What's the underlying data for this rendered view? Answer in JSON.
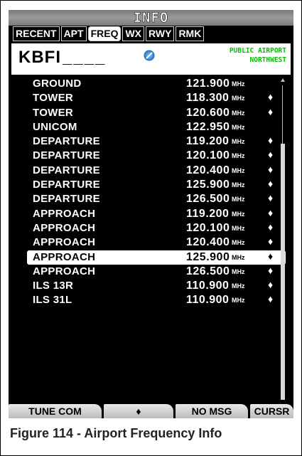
{
  "title": "INFO",
  "tabs": [
    {
      "label": "RECENT",
      "active": false
    },
    {
      "label": "APT",
      "active": false
    },
    {
      "label": "FREQ",
      "active": true
    },
    {
      "label": "WX",
      "active": false
    },
    {
      "label": "RWY",
      "active": false
    },
    {
      "label": "RMK",
      "active": false
    }
  ],
  "airport": {
    "ident": "KBFI",
    "ident_cursor": "____",
    "type": "PUBLIC AIRPORT",
    "region": "NORTHWEST",
    "icon": "public-airport-icon"
  },
  "frequencies": [
    {
      "name": "GROUND",
      "freq": "121.900",
      "unit": "MHz",
      "marker": ""
    },
    {
      "name": "TOWER",
      "freq": "118.300",
      "unit": "MHz",
      "marker": "♦"
    },
    {
      "name": "TOWER",
      "freq": "120.600",
      "unit": "MHz",
      "marker": "♦"
    },
    {
      "name": "UNICOM",
      "freq": "122.950",
      "unit": "MHz",
      "marker": ""
    },
    {
      "name": "DEPARTURE",
      "freq": "119.200",
      "unit": "MHz",
      "marker": "♦"
    },
    {
      "name": "DEPARTURE",
      "freq": "120.100",
      "unit": "MHz",
      "marker": "♦"
    },
    {
      "name": "DEPARTURE",
      "freq": "120.400",
      "unit": "MHz",
      "marker": "♦"
    },
    {
      "name": "DEPARTURE",
      "freq": "125.900",
      "unit": "MHz",
      "marker": "♦"
    },
    {
      "name": "DEPARTURE",
      "freq": "126.500",
      "unit": "MHz",
      "marker": "♦"
    },
    {
      "name": "APPROACH",
      "freq": "119.200",
      "unit": "MHz",
      "marker": "♦"
    },
    {
      "name": "APPROACH",
      "freq": "120.100",
      "unit": "MHz",
      "marker": "♦"
    },
    {
      "name": "APPROACH",
      "freq": "120.400",
      "unit": "MHz",
      "marker": "♦"
    },
    {
      "name": "APPROACH",
      "freq": "125.900",
      "unit": "MHz",
      "marker": "♦",
      "selected": true
    },
    {
      "name": "APPROACH",
      "freq": "126.500",
      "unit": "MHz",
      "marker": "♦"
    },
    {
      "name": "ILS 13R",
      "freq": "110.900",
      "unit": "MHz",
      "marker": "♦"
    },
    {
      "name": "ILS 31L",
      "freq": "110.900",
      "unit": "MHz",
      "marker": "♦"
    }
  ],
  "softkeys": [
    "TUNE COM",
    "♦",
    "NO MSG",
    "CURSR"
  ],
  "caption": "Figure 114 - Airport Frequency Info",
  "colors": {
    "screen_bg": "#000000",
    "text": "#ffffff",
    "airport_type": "#00c000",
    "airport_icon": "#3a8fd8"
  }
}
